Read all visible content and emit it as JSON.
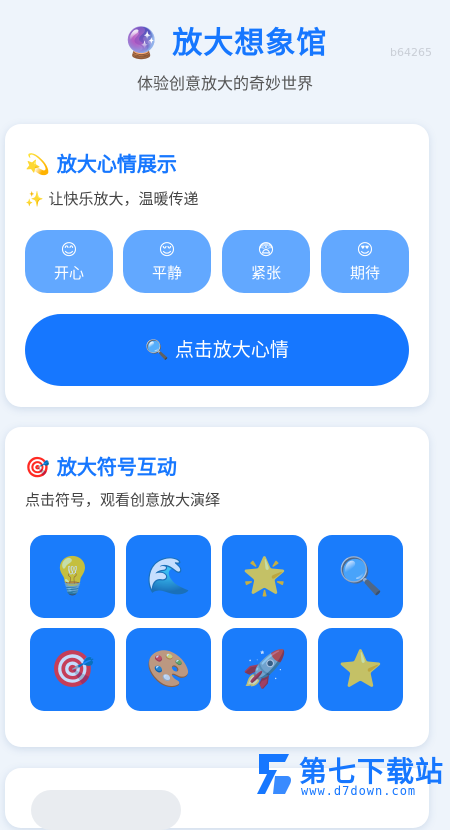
{
  "header": {
    "icon": "🔮",
    "title": "放大想象馆",
    "subtitle": "体验创意放大的奇妙世界",
    "watermark": "b64265"
  },
  "mood_card": {
    "icon": "💫",
    "title": "放大心情展示",
    "subtitle_icon": "✨",
    "subtitle": "让快乐放大，温暖传递",
    "moods": [
      {
        "emoji": "😊",
        "label": "开心"
      },
      {
        "emoji": "😌",
        "label": "平静"
      },
      {
        "emoji": "😨",
        "label": "紧张"
      },
      {
        "emoji": "😍",
        "label": "期待"
      }
    ],
    "button_icon": "🔍",
    "button_label": "点击放大心情"
  },
  "symbol_card": {
    "icon": "🎯",
    "title": "放大符号互动",
    "subtitle": "点击符号，观看创意放大演绎",
    "symbols": [
      {
        "glyph": "💡",
        "name": "lightbulb-icon"
      },
      {
        "glyph": "🌊",
        "name": "wave-icon"
      },
      {
        "glyph": "🌟",
        "name": "glowing-star-icon"
      },
      {
        "glyph": "🔍",
        "name": "magnifier-icon"
      },
      {
        "glyph": "🎯",
        "name": "target-icon"
      },
      {
        "glyph": "🎨",
        "name": "palette-icon"
      },
      {
        "glyph": "🚀",
        "name": "rocket-icon"
      },
      {
        "glyph": "⭐",
        "name": "star-icon"
      }
    ]
  },
  "site_logo": {
    "name": "第七下载站",
    "url": "www.d7down.com"
  },
  "colors": {
    "accent": "#1677ff",
    "mood_button": "#62a8ff",
    "background": "#eef4fb"
  }
}
